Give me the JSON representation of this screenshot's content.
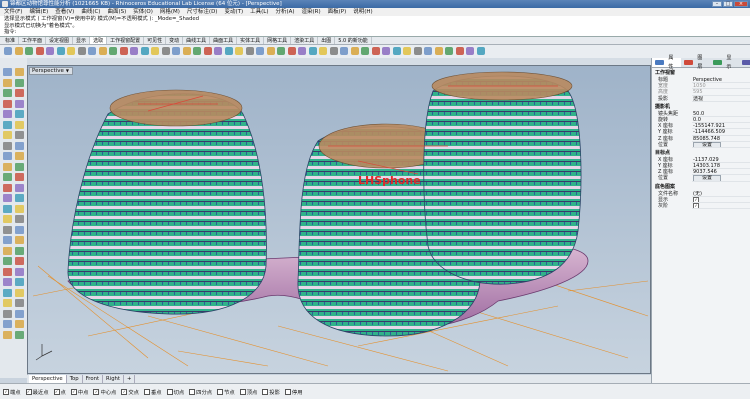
{
  "window": {
    "title": "锦都区动物馆尊性能分析 (1021665 KB) - Rhinoceros Educational Lab License (64 位元) - [Perspective]"
  },
  "menu": [
    "文件(F)",
    "编辑(E)",
    "查看(V)",
    "曲线(C)",
    "曲面(S)",
    "实体(O)",
    "网格(M)",
    "尺寸标注(D)",
    "变动(T)",
    "工具(L)",
    "分析(A)",
    "渲染(R)",
    "面板(P)",
    "说明(H)"
  ],
  "command": {
    "line1": "选择显示模式 ( 工作视窗(V)=使用中的  模式(M)=不透明模式 ): _Mode=_Shaded",
    "line2": "显示模式已切换为\"着色模式\"。",
    "prompt": "指令:"
  },
  "toolbar_tabs": [
    "标准",
    "工作平面",
    "设定视图",
    "显示",
    "选取",
    "工作视窗配置",
    "可见性",
    "变动",
    "曲线工具",
    "曲面工具",
    "实体工具",
    "网格工具",
    "渲染工具",
    "出图",
    "5.0 的新功能"
  ],
  "toolbar_active_tab": 4,
  "viewport": {
    "label": "Perspective",
    "model_text": "LHSphone"
  },
  "properties_panel": {
    "tabs": [
      "属性",
      "图层",
      "显示",
      "说明"
    ],
    "active_tab": 0,
    "sections": [
      {
        "title": "工作视窗",
        "rows": [
          {
            "k": "标题",
            "v": "Perspective"
          },
          {
            "k": "宽度",
            "v": "1050",
            "dim": true
          },
          {
            "k": "高度",
            "v": "595",
            "dim": true
          },
          {
            "k": "投影",
            "v": "透视"
          }
        ]
      },
      {
        "title": "摄影机",
        "rows": [
          {
            "k": "镜头焦距",
            "v": "50.0"
          },
          {
            "k": "旋转",
            "v": "0.0"
          },
          {
            "k": "X 座标",
            "v": "-155147.921"
          },
          {
            "k": "Y 座标",
            "v": "-114466.509"
          },
          {
            "k": "Z 座标",
            "v": "85085.748"
          },
          {
            "k": "位置",
            "v": "设置",
            "button": true
          }
        ]
      },
      {
        "title": "目标点",
        "rows": [
          {
            "k": "X 座标",
            "v": "-1137.029"
          },
          {
            "k": "Y 座标",
            "v": "14303.178"
          },
          {
            "k": "Z 座标",
            "v": "9037.546"
          },
          {
            "k": "位置",
            "v": "设置",
            "button": true
          }
        ]
      },
      {
        "title": "底色图案",
        "rows": [
          {
            "k": "文件名称",
            "v": "(无)"
          },
          {
            "k": "显示",
            "v": "✓",
            "check": true
          },
          {
            "k": "灰阶",
            "v": "✓",
            "check": true
          }
        ]
      }
    ]
  },
  "view_tabs": [
    "Perspective",
    "Top",
    "Front",
    "Right",
    "+"
  ],
  "snaps": [
    {
      "label": "端点",
      "checked": true
    },
    {
      "label": "最近点",
      "checked": true
    },
    {
      "label": "点",
      "checked": true
    },
    {
      "label": "中点",
      "checked": true
    },
    {
      "label": "中心点",
      "checked": true
    },
    {
      "label": "交点",
      "checked": true
    },
    {
      "label": "垂点",
      "checked": false
    },
    {
      "label": "切点",
      "checked": false
    },
    {
      "label": "四分点",
      "checked": false
    },
    {
      "label": "节点",
      "checked": false
    },
    {
      "label": "顶点",
      "checked": false
    },
    {
      "label": "投影",
      "checked": false
    },
    {
      "label": "停用",
      "checked": false
    }
  ],
  "colors": {
    "accent_orange": "#e88a1a",
    "model_green": "#2fb58a",
    "model_purple": "#a06bd0",
    "model_red": "#d84a3a"
  }
}
